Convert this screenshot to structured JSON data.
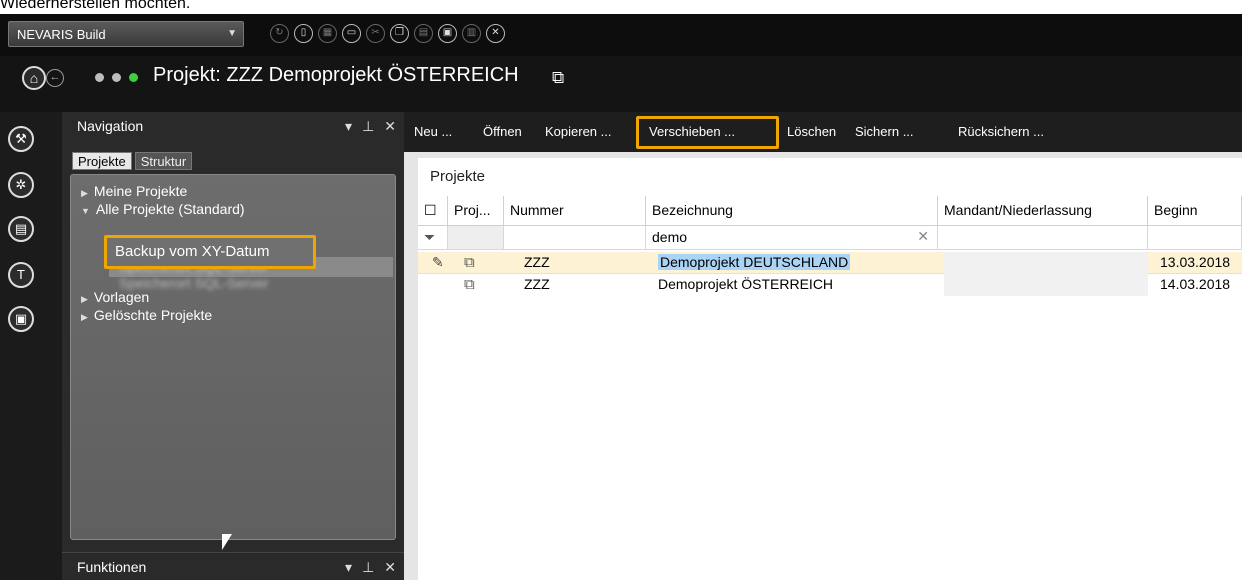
{
  "caption": "Wiederherstellen möchten.",
  "app": {
    "selector_label": "NEVARIS Build",
    "toolbar_icons": [
      "reload-icon",
      "new-doc-icon",
      "grid-icon",
      "open-folder-icon",
      "cut-icon",
      "copy-icon",
      "paste-icon",
      "save-icon",
      "print-icon",
      "close-icon"
    ]
  },
  "title": {
    "project": "Projekt: ZZZ Demoprojekt ÖSTERREICH",
    "dots": [
      "#bdbdbd",
      "#bdbdbd",
      "#3ecf3e"
    ]
  },
  "nav": {
    "title": "Navigation",
    "tabs": [
      "Projekte",
      "Struktur"
    ],
    "tree": {
      "my_projects": "Meine Projekte",
      "all_projects": "Alle Projekte (Standard)",
      "backup": "Backup vom XY-Datum",
      "blurred1": "Speicherort SQL-Server",
      "blurred2": "Speicherort SQL-Server",
      "templates": "Vorlagen",
      "deleted": "Gelöschte Projekte"
    },
    "functions_title": "Funktionen"
  },
  "menu": {
    "new": "Neu ...",
    "open": "Öffnen",
    "copy": "Kopieren ...",
    "move": "Verschieben ...",
    "delete": "Löschen",
    "save": "Sichern ...",
    "restore": "Rücksichern ..."
  },
  "grid": {
    "title": "Projekte",
    "headers": [
      "Proj...",
      "Nummer",
      "Bezeichnung",
      "Mandant/Niederlassung",
      "Beginn"
    ],
    "filter_value": "demo",
    "rows": [
      {
        "nummer": "ZZZ",
        "bezeichnung": "Demoprojekt DEUTSCHLAND",
        "mandant": "",
        "beginn": "13.03.2018"
      },
      {
        "nummer": "ZZZ",
        "bezeichnung": "Demoprojekt ÖSTERREICH",
        "mandant": "",
        "beginn": "14.03.2018"
      }
    ]
  },
  "colors": {
    "highlight": "#f0a500",
    "selected_row": "#fdf3d4",
    "selection_text": "#aad4f5"
  }
}
